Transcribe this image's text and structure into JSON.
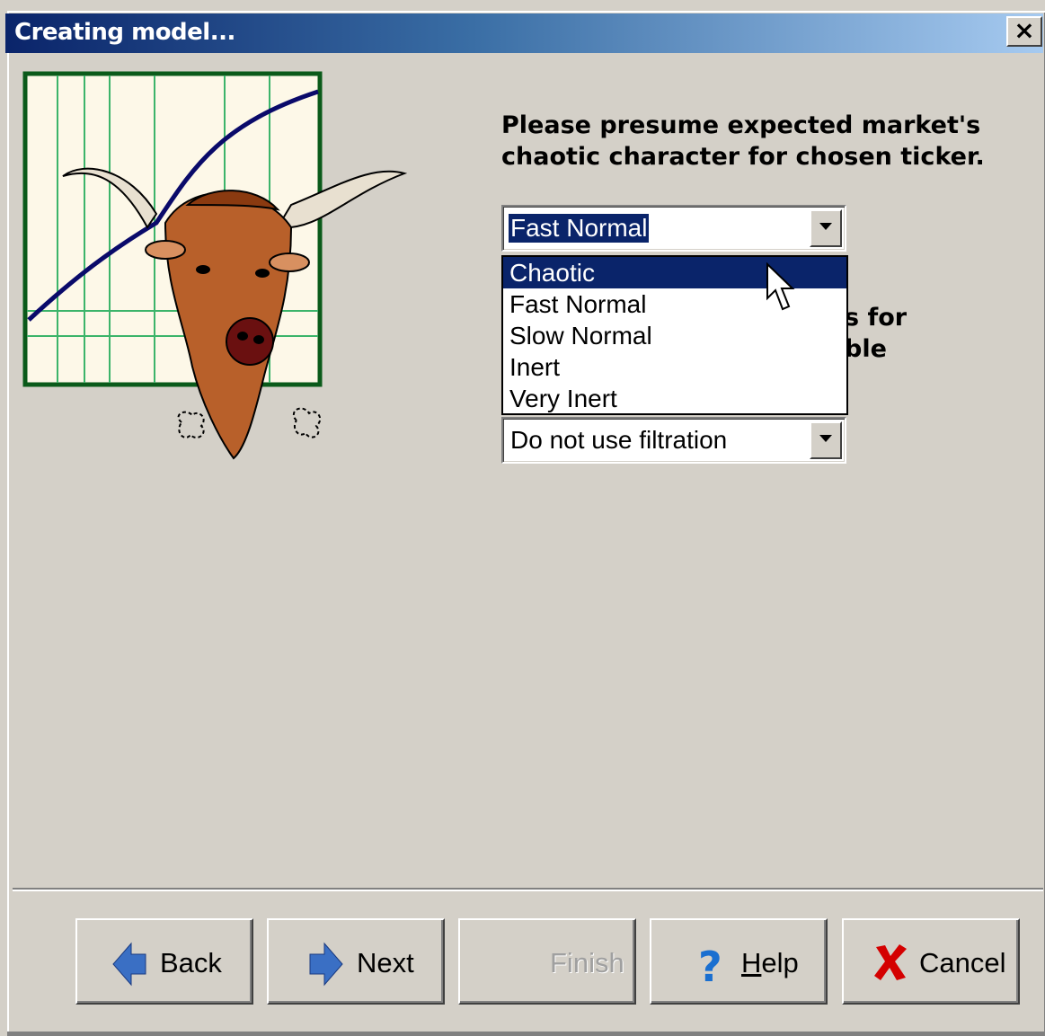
{
  "window": {
    "title": "Creating model...",
    "close_label": "×"
  },
  "prompt": {
    "text": "Please presume expected market's\nchaotic character for chosen ticker.",
    "partial_line1": "s for",
    "partial_line2": "ble"
  },
  "chaos_combo": {
    "value": "Fast Normal",
    "options": [
      "Chaotic",
      "Fast Normal",
      "Slow Normal",
      "Inert",
      "Very Inert"
    ],
    "highlighted": "Chaotic"
  },
  "filter_combo": {
    "value": "Do not use filtration"
  },
  "buttons": {
    "back": "Back",
    "next": "Next",
    "finish": "Finish",
    "help": "Help",
    "cancel": "Cancel"
  },
  "icons": {
    "back": "left-arrow-icon",
    "next": "right-arrow-icon",
    "help": "question-icon",
    "cancel": "red-x-icon",
    "cursor": "mouse-pointer-icon"
  },
  "colors": {
    "title_gradient_start": "#0a246a",
    "title_gradient_end": "#a6caf0",
    "selection": "#0a246a",
    "arrow_blue": "#3a6fc4",
    "cancel_red": "#d40000"
  }
}
